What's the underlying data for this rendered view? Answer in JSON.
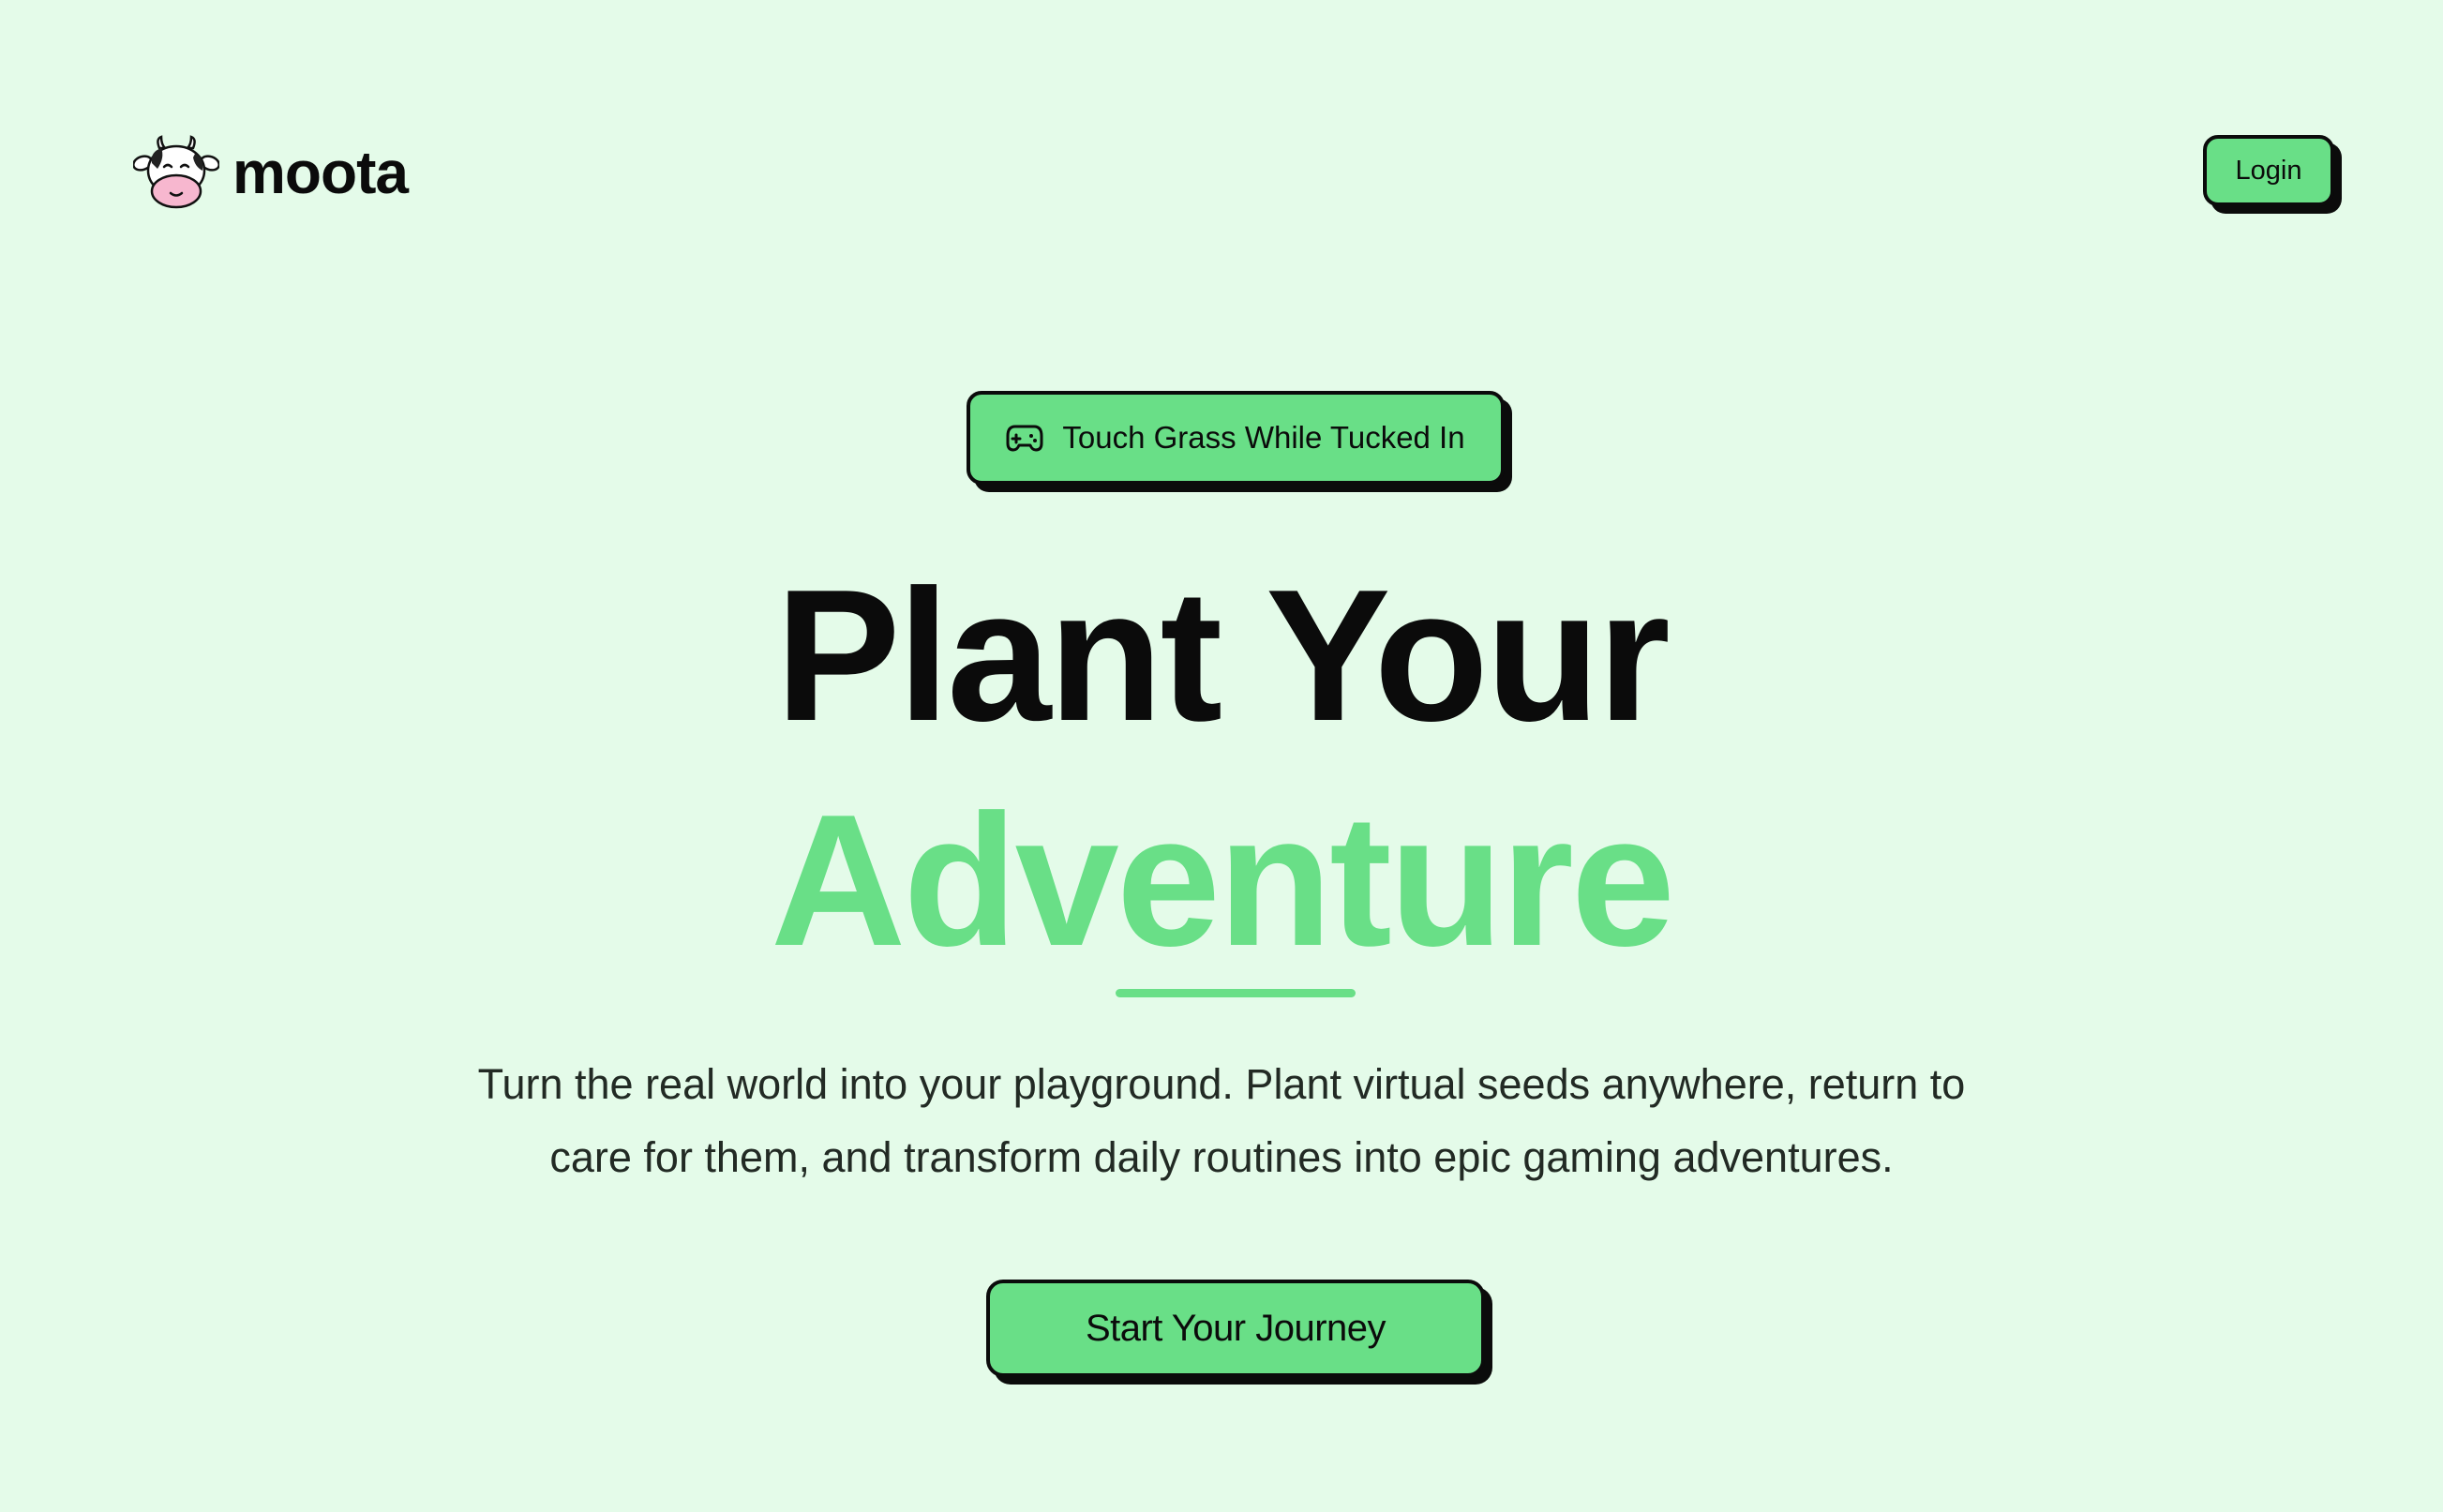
{
  "header": {
    "brand_name": "moota",
    "logo_icon": "cow-face-icon",
    "login_label": "Login"
  },
  "hero": {
    "badge": {
      "icon": "gamepad-icon",
      "label": "Touch Grass While Tucked In"
    },
    "headline_line1": "Plant Your",
    "headline_line2": "Adventure",
    "subtitle_line1": "Turn the real world into your playground. Plant virtual seeds anywhere, return to",
    "subtitle_line2": "care for them, and transform daily routines into epic gaming adventures.",
    "cta_label": "Start Your Journey"
  },
  "colors": {
    "background": "#e4fbe9",
    "accent_green": "#69df87",
    "ink": "#0b0b0b"
  }
}
